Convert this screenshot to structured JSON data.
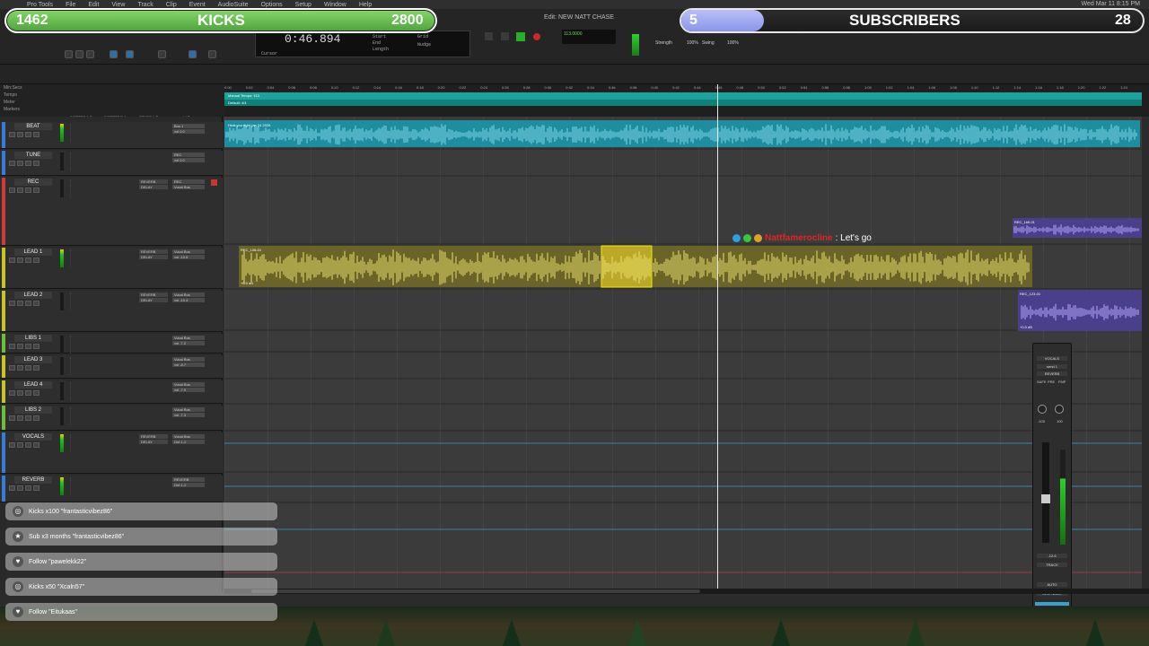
{
  "menubar": {
    "items": [
      "Pro Tools",
      "File",
      "Edit",
      "View",
      "Track",
      "Clip",
      "Event",
      "AudioSuite",
      "Options",
      "Setup",
      "Window",
      "Help"
    ],
    "clock": "Wed Mar 11 8:15 PM"
  },
  "window": {
    "title": "Edit: NEW NATT CHASE"
  },
  "transport": {
    "counter_main": "0:46.894",
    "start_label": "Start",
    "end_label": "End",
    "length_label": "Length",
    "cursor_label": "Cursor",
    "grid_label": "Grid",
    "nudge_label": "Nudge",
    "tempo_value": "113.0000",
    "strength_label": "Strength",
    "strength_value": "100%",
    "swing_label": "Swing",
    "swing_value": "100%"
  },
  "overlay": {
    "kicks_count": "1462",
    "kicks_label": "KICKS",
    "kicks_goal": "2800",
    "kicks_progress": 0.522,
    "subs_count": "5",
    "subs_label": "SUBSCRIBERS",
    "subs_goal": "28",
    "subs_progress": 0.179
  },
  "ruler": {
    "rows": [
      "Min:Secs",
      "Tempo",
      "Meter",
      "Markers"
    ],
    "tempo_text": "Manual Tempo: 113",
    "meter_text": "Default: 4/4",
    "ticks": [
      "0:00",
      "0:02",
      "0:04",
      "0:06",
      "0:08",
      "0:10",
      "0:12",
      "0:14",
      "0:16",
      "0:18",
      "0:20",
      "0:22",
      "0:24",
      "0:26",
      "0:28",
      "0:30",
      "0:32",
      "0:34",
      "0:36",
      "0:38",
      "0:40",
      "0:42",
      "0:44",
      "0:46",
      "0:48",
      "0:50",
      "0:52",
      "0:54",
      "0:56",
      "0:58",
      "1:00",
      "1:02",
      "1:04",
      "1:06",
      "1:08",
      "1:10",
      "1:12",
      "1:14",
      "1:16",
      "1:18",
      "1:20",
      "1:22",
      "1:24"
    ]
  },
  "track_headers": {
    "inserts_ae": "INSERTS A-E",
    "inserts_fj": "INSERTS F-J",
    "sends": "SENDS A-E",
    "io": "I / O"
  },
  "tracks": [
    {
      "name": "BEAT",
      "color": "#3a7bd5",
      "sends": [
        "",
        ""
      ],
      "io": [
        "Bus 1",
        "vol 0.0"
      ],
      "level": true
    },
    {
      "name": "TUNE",
      "color": "#3a7bd5",
      "sends": [
        "",
        ""
      ],
      "io": [
        "REC",
        "vol 0.0"
      ],
      "level": false
    },
    {
      "name": "REC",
      "color": "#d13a3a",
      "sends": [
        "REVERB",
        "DELAY"
      ],
      "io": [
        "REC",
        "Vocal Bus"
      ],
      "level": false
    },
    {
      "name": "LEAD 1",
      "color": "#c7c42b",
      "sends": [
        "REVERB",
        "DELAY"
      ],
      "io": [
        "Vocal Bus",
        "vol -10.6"
      ],
      "level": true
    },
    {
      "name": "LEAD 2",
      "color": "#c7c42b",
      "sends": [
        "REVERB",
        "DELAY"
      ],
      "io": [
        "Vocal Bus",
        "vol -10.4"
      ],
      "level": false
    },
    {
      "name": "LIBS 1",
      "color": "#6bbd3a",
      "sends": [
        "",
        ""
      ],
      "io": [
        "Vocal Bus",
        "vol -7.2"
      ],
      "level": false
    },
    {
      "name": "LEAD 3",
      "color": "#c7c42b",
      "sends": [
        "",
        ""
      ],
      "io": [
        "Vocal Bus",
        "vol -8.7"
      ],
      "level": false
    },
    {
      "name": "LEAD 4",
      "color": "#c7c42b",
      "sends": [
        "",
        ""
      ],
      "io": [
        "Vocal Bus",
        "vol -7.0"
      ],
      "level": false
    },
    {
      "name": "LIBS 2",
      "color": "#6bbd3a",
      "sends": [
        "",
        ""
      ],
      "io": [
        "Vocal Bus",
        "vol -7.3"
      ],
      "level": false
    },
    {
      "name": "VOCALS",
      "color": "#3a7bd5",
      "sends": [
        "REVERB",
        "DELAY"
      ],
      "io": [
        "Vocal Bus",
        "Out 1-2"
      ],
      "level": true
    },
    {
      "name": "REVERB",
      "color": "#3a7bd5",
      "sends": [
        "",
        ""
      ],
      "io": [
        "REVERB",
        "Out 1-2"
      ],
      "level": true
    }
  ],
  "clips": {
    "beat": "Heat you right (an 24 2026",
    "rec_a": "REC_1bfl-01",
    "rec_b": "REC_1bl-01",
    "lead": "REC_108-01",
    "lead_b": "REC_123-01",
    "lead_gain": "+0.0 dB",
    "vol_gain": "+0.0 dB"
  },
  "chat": {
    "username": "Nattfamerocline",
    "message": ": Let's go"
  },
  "mixer": {
    "track": "VOCALS",
    "insert": "send 1",
    "send": "REVERB",
    "buttons": [
      "SAFE",
      "PRE",
      "FMP"
    ],
    "pan_values": [
      "-100",
      "100"
    ],
    "output": "Vocal Bus",
    "volume": "-12.6",
    "label_track": "TRACK",
    "label_auto": "AUTO",
    "name_bottom": "NEW NAME"
  },
  "alerts": [
    {
      "icon": "kick-icon",
      "text": "Kicks x100 \"frantasticvibez86\""
    },
    {
      "icon": "star-icon",
      "text": "Sub x3 months \"frantasticvibez86\""
    },
    {
      "icon": "heart-icon",
      "text": "Follow \"pawelekk22\""
    },
    {
      "icon": "kick-icon",
      "text": "Kicks x50 \"Xcaln57\""
    },
    {
      "icon": "heart-icon",
      "text": "Follow \"Eitukaas\""
    }
  ],
  "colors": {
    "accent_green": "#4fa23c",
    "subs_fill": "#8b95ea",
    "beat_clip": "#1e8da0",
    "lead_clip": "#6b6428",
    "rec_clip": "#4a3f8a",
    "playhead": "#e8e8e8"
  }
}
